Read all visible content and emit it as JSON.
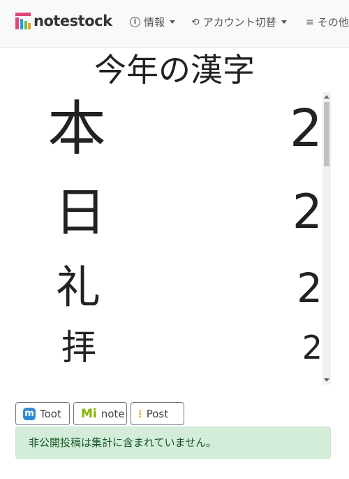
{
  "navbar": {
    "brand": "notestock",
    "items": [
      {
        "label": "情報",
        "icon": "info-icon"
      },
      {
        "label": "アカウント切替",
        "icon": "account-switch-icon"
      },
      {
        "label": "その他",
        "icon": "menu-icon"
      }
    ]
  },
  "page": {
    "title": "今年の漢字"
  },
  "kanji_list": [
    {
      "kanji": "本",
      "count": "2"
    },
    {
      "kanji": "日",
      "count": "2"
    },
    {
      "kanji": "礼",
      "count": "2"
    },
    {
      "kanji": "拝",
      "count": "2"
    }
  ],
  "share": {
    "toot": "Toot",
    "note": "note",
    "post": "Post"
  },
  "alert": {
    "message": "非公開投稿は集計に含まれていません。"
  },
  "colors": {
    "alert_bg": "#d4edda",
    "alert_text": "#155724",
    "brand_pink": "#e0457b",
    "mastodon_blue": "#3088d4",
    "misskey_green": "#86b300"
  }
}
